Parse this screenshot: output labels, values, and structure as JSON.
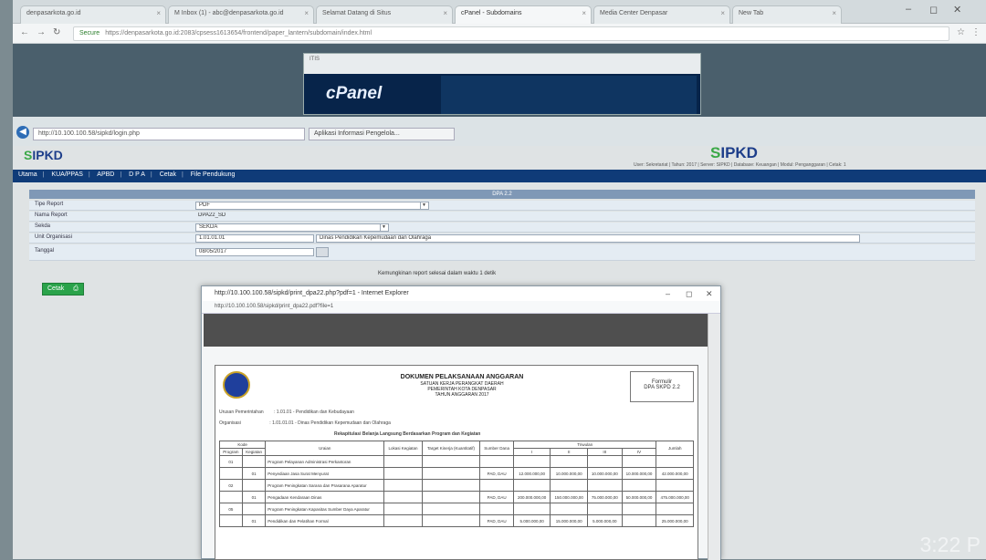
{
  "browser": {
    "tabs": [
      {
        "label": "denpasarkota.go.id"
      },
      {
        "label": "M Inbox (1) - abc@denpasarkota.go.id"
      },
      {
        "label": "Selamat Datang di Situs"
      },
      {
        "label": "cPanel - Subdomains"
      },
      {
        "label": "Media Center Denpasar"
      },
      {
        "label": "New Tab"
      }
    ],
    "secure_label": "Secure",
    "url": "https://denpasarkota.go.id:2083/cpsess1613654/frontend/paper_lantern/subdomain/index.html",
    "controls": {
      "minimize": "–",
      "restore": "◻",
      "close": "✕"
    }
  },
  "cpanel": {
    "logo": "cPanel",
    "strip_text": "ITIS"
  },
  "ie": {
    "url": "http://10.100.100.58/sipkd/login.php",
    "tab": "Aplikasi Informasi Pengelola..."
  },
  "sipkd": {
    "logo_prefix": "S",
    "logo_rest": "IPKD",
    "userline": "User: Sekretariat | Tahun: 2017 | Server: SIPKD | Database: Keuangan | Modul: Penganggaran | Cetak: 1",
    "menu": [
      "Utama",
      "KUA/PPAS",
      "APBD",
      "D P A",
      "Cetak",
      "File Pendukung"
    ],
    "form_header": "DPA 2.2",
    "fields": [
      {
        "label": "Tipe Report",
        "value": "PDF",
        "select": true
      },
      {
        "label": "Nama Report",
        "value": "DPA22_SD",
        "select": false
      },
      {
        "label": "Sekda",
        "value": "SEKDA",
        "select": true
      },
      {
        "label": "Unit Organisasi",
        "value": "1.01.01.01",
        "extra": "Dinas Pendidikan Kepemudaan dan Olahraga",
        "select": false
      },
      {
        "label": "Tanggal",
        "value": "08/05/2017",
        "select": false
      }
    ],
    "notice": "Kemungkinan report selesai dalam waktu 1 detik",
    "cetak_button": "Cetak"
  },
  "popup": {
    "title": "http://10.100.100.58/sipkd/print_dpa22.php?pdf=1 - Internet Explorer",
    "url": "http://10.100.100.58/sipkd/print_dpa22.pdf?file=1",
    "doc": {
      "title": "DOKUMEN PELAKSANAAN ANGGARAN",
      "sub1": "SATUAN KERJA PERANGKAT DAERAH",
      "sub2": "PEMERINTAH KOTA DENPASAR",
      "sub3": "TAHUN ANGGARAN 2017",
      "formulir_line1": "Formulir",
      "formulir_line2": "DPA SKPD 2.2",
      "urusan_label": "Urusan Pemerintahan",
      "urusan_value": ": 1.01.01 - Pendidikan dan Kebudayaan",
      "org_label": "Organisasi",
      "org_value": ": 1.01.01.01 - Dinas Pendidikan Kepemudaan dan Olahraga",
      "table_caption": "Rekapitulasi Belanja Langsung Berdasarkan Program dan Kegiatan",
      "headers": [
        "Kode",
        "Uraian",
        "Lokasi Kegiatan",
        "Target Kinerja (Kuantitatif)",
        "Sumber Dana",
        "Triwulan",
        "Jumlah"
      ],
      "subheaders": [
        "Program",
        "Kegiatan",
        "I",
        "II",
        "III",
        "IV"
      ],
      "rows": [
        {
          "program": "01",
          "kegiatan": "",
          "uraian": "Program Pelayanan Administrasi Perkantoran",
          "sumber": "",
          "t1": "",
          "t2": "",
          "t3": "",
          "t4": "",
          "jumlah": ""
        },
        {
          "program": "",
          "kegiatan": "01",
          "uraian": "Penyediaan Jasa Surat Menyurat",
          "sumber": "PAD, DAU",
          "t1": "12.000.000,00",
          "t2": "10.000.000,00",
          "t3": "10.000.000,00",
          "t4": "10.000.000,00",
          "jumlah": "42.000.000,00"
        },
        {
          "program": "02",
          "kegiatan": "",
          "uraian": "Program Peningkatan Sarana dan Prasarana Aparatur",
          "sumber": "",
          "t1": "",
          "t2": "",
          "t3": "",
          "t4": "",
          "jumlah": ""
        },
        {
          "program": "",
          "kegiatan": "01",
          "uraian": "Pengadaan Kendaraan Dinas",
          "sumber": "PAD, DAU",
          "t1": "200.000.000,00",
          "t2": "150.000.000,00",
          "t3": "75.000.000,00",
          "t4": "50.000.000,00",
          "jumlah": "475.000.000,00"
        },
        {
          "program": "05",
          "kegiatan": "",
          "uraian": "Program Peningkatan Kapasitas Sumber Daya Aparatur",
          "sumber": "",
          "t1": "",
          "t2": "",
          "t3": "",
          "t4": "",
          "jumlah": ""
        },
        {
          "program": "",
          "kegiatan": "01",
          "uraian": "Pendidikan dan Pelatihan Formal",
          "sumber": "PAD, DAU",
          "t1": "5.000.000,00",
          "t2": "15.000.000,00",
          "t3": "5.000.000,00",
          "t4": "",
          "jumlah": "25.000.000,00"
        }
      ]
    }
  },
  "overlay": {
    "clock": "3:22 P"
  }
}
